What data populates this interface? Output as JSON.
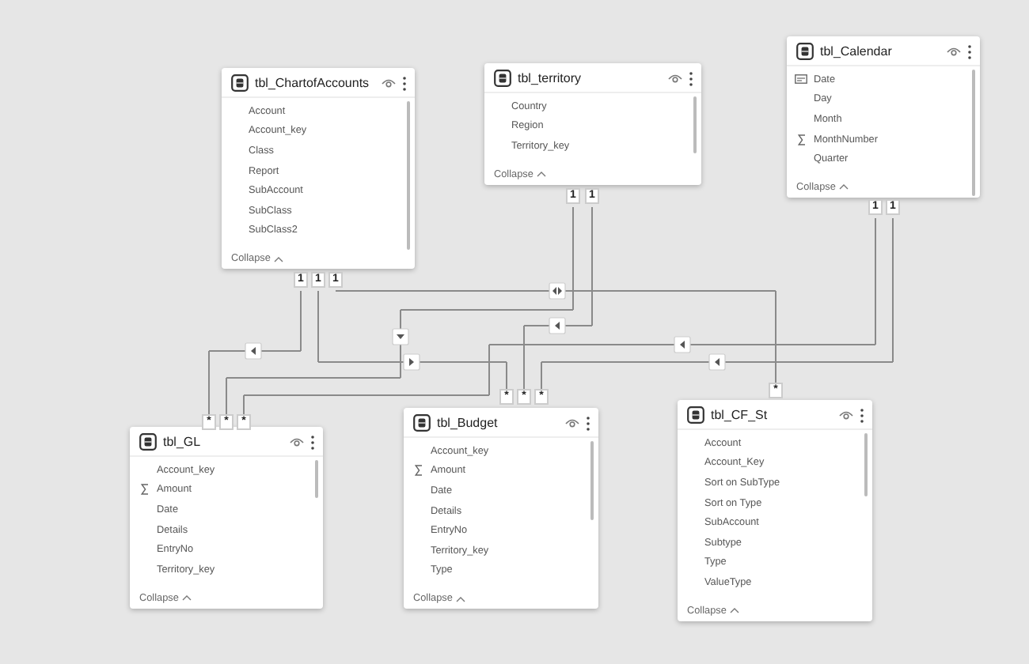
{
  "tables": [
    {
      "title": "tbl_ChartofAccounts",
      "fields": [
        {
          "name": "Account",
          "kind": "text"
        },
        {
          "name": "Account_key",
          "kind": "text"
        },
        {
          "name": "Class",
          "kind": "text"
        },
        {
          "name": "Report",
          "kind": "text"
        },
        {
          "name": "SubAccount",
          "kind": "text"
        },
        {
          "name": "SubClass",
          "kind": "text"
        },
        {
          "name": "SubClass2",
          "kind": "text"
        }
      ],
      "collapse": "Collapse"
    },
    {
      "title": "tbl_territory",
      "fields": [
        {
          "name": "Country",
          "kind": "text"
        },
        {
          "name": "Region",
          "kind": "text"
        },
        {
          "name": "Territory_key",
          "kind": "text"
        }
      ],
      "collapse": "Collapse"
    },
    {
      "title": "tbl_Calendar",
      "fields": [
        {
          "name": "Date",
          "kind": "date"
        },
        {
          "name": "Day",
          "kind": "text"
        },
        {
          "name": "Month",
          "kind": "text"
        },
        {
          "name": "MonthNumber",
          "kind": "sum"
        },
        {
          "name": "Quarter",
          "kind": "text"
        }
      ],
      "collapse": "Collapse"
    },
    {
      "title": "tbl_GL",
      "fields": [
        {
          "name": "Account_key",
          "kind": "text"
        },
        {
          "name": "Amount",
          "kind": "sum"
        },
        {
          "name": "Date",
          "kind": "text"
        },
        {
          "name": "Details",
          "kind": "text"
        },
        {
          "name": "EntryNo",
          "kind": "text"
        },
        {
          "name": "Territory_key",
          "kind": "text"
        }
      ],
      "collapse": "Collapse"
    },
    {
      "title": "tbl_Budget",
      "fields": [
        {
          "name": "Account_key",
          "kind": "text"
        },
        {
          "name": "Amount",
          "kind": "sum"
        },
        {
          "name": "Date",
          "kind": "text"
        },
        {
          "name": "Details",
          "kind": "text"
        },
        {
          "name": "EntryNo",
          "kind": "text"
        },
        {
          "name": "Territory_key",
          "kind": "text"
        },
        {
          "name": "Type",
          "kind": "text"
        }
      ],
      "collapse": "Collapse"
    },
    {
      "title": "tbl_CF_St",
      "fields": [
        {
          "name": "Account",
          "kind": "text"
        },
        {
          "name": "Account_Key",
          "kind": "text"
        },
        {
          "name": "Sort on SubType",
          "kind": "text"
        },
        {
          "name": "Sort on Type",
          "kind": "text"
        },
        {
          "name": "SubAccount",
          "kind": "text"
        },
        {
          "name": "Subtype",
          "kind": "text"
        },
        {
          "name": "Type",
          "kind": "text"
        },
        {
          "name": "ValueType",
          "kind": "text"
        }
      ],
      "collapse": "Collapse"
    }
  ],
  "relationships": [
    {
      "from_cardinality": "1",
      "to_cardinality": "*",
      "kind": "left"
    },
    {
      "from_cardinality": "1",
      "to_cardinality": "*",
      "kind": "right"
    },
    {
      "from_cardinality": "1",
      "to_cardinality": "*",
      "kind": "both"
    },
    {
      "from_cardinality": "1",
      "to_cardinality": "*",
      "kind": "down"
    },
    {
      "from_cardinality": "1",
      "to_cardinality": "*",
      "kind": "left"
    },
    {
      "from_cardinality": "1",
      "to_cardinality": "*",
      "kind": "left"
    },
    {
      "from_cardinality": "1",
      "to_cardinality": "*",
      "kind": "left"
    }
  ]
}
